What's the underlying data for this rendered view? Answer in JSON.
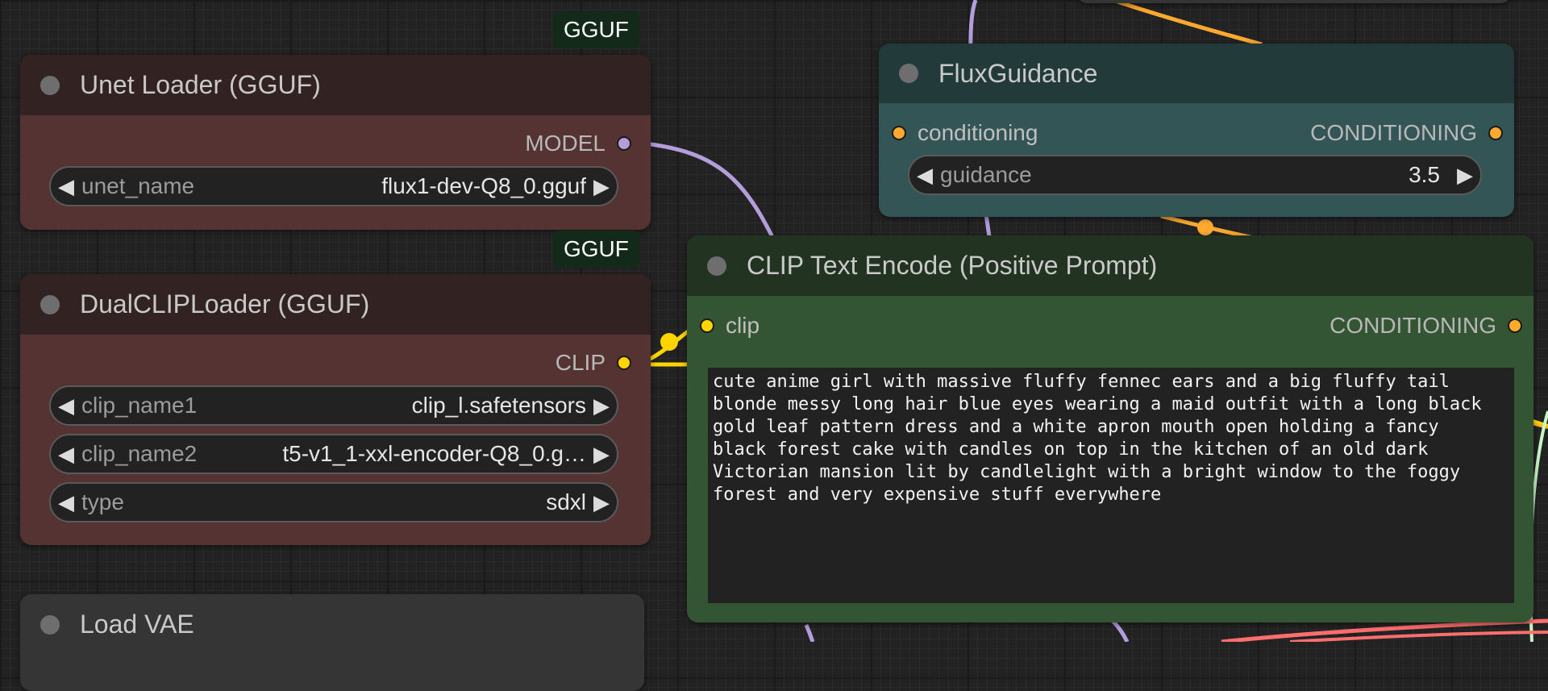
{
  "nodes": {
    "unet_loader": {
      "badge": "GGUF",
      "title": "Unet Loader (GGUF)",
      "output": {
        "label": "MODEL",
        "color": "#b39ddb"
      },
      "widgets": [
        {
          "label": "unet_name",
          "value": "flux1-dev-Q8_0.gguf"
        }
      ]
    },
    "dual_clip_loader": {
      "badge": "GGUF",
      "title": "DualCLIPLoader (GGUF)",
      "output": {
        "label": "CLIP",
        "color": "#ffd500"
      },
      "widgets": [
        {
          "label": "clip_name1",
          "value": "clip_l.safetensors"
        },
        {
          "label": "clip_name2",
          "value": "t5-v1_1-xxl-encoder-Q8_0.g…"
        },
        {
          "label": "type",
          "value": "sdxl"
        }
      ]
    },
    "load_vae": {
      "title": "Load VAE"
    },
    "flux_guidance": {
      "title": "FluxGuidance",
      "input": {
        "label": "conditioning",
        "color": "#ffa931"
      },
      "output": {
        "label": "CONDITIONING",
        "color": "#ffa931"
      },
      "widgets": [
        {
          "label": "guidance",
          "value": "3.5"
        }
      ]
    },
    "clip_text_encode": {
      "title": "CLIP Text Encode (Positive Prompt)",
      "input": {
        "label": "clip",
        "color": "#ffd500"
      },
      "output": {
        "label": "CONDITIONING",
        "color": "#ffa931"
      },
      "prompt": "cute anime girl with massive fluffy fennec ears and a big fluffy tail\nblonde messy long hair blue eyes wearing a maid outfit with a long black\ngold leaf pattern dress and a white apron mouth open holding a fancy\nblack forest cake with candles on top in the kitchen of an old dark\nVictorian mansion lit by candlelight with a bright window to the foggy\nforest and very expensive stuff everywhere"
    }
  },
  "icons": {
    "decrement": "◀",
    "increment": "▶"
  },
  "colors": {
    "model_wire": "#b39ddb",
    "clip_wire": "#ffd500",
    "conditioning_wire": "#ffa931",
    "vae_wire": "#ff6e6e",
    "latent_wire": "#c8f7c5"
  }
}
